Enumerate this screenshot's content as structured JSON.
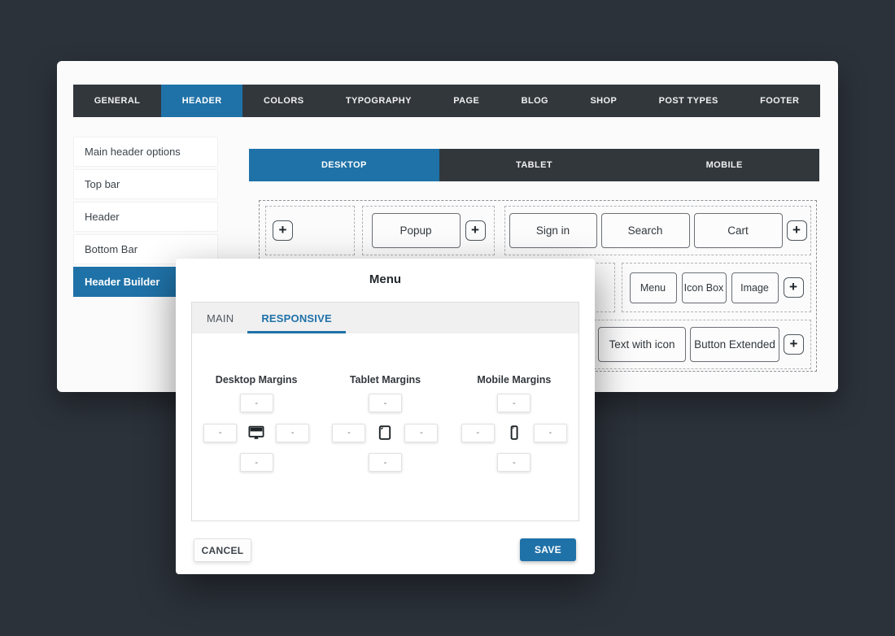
{
  "colors": {
    "accent": "#1f72a8",
    "nav_bg": "#32373c",
    "page_bg": "#2c323a"
  },
  "top_nav": {
    "tabs": [
      {
        "label": "GENERAL"
      },
      {
        "label": "HEADER",
        "active": true
      },
      {
        "label": "COLORS"
      },
      {
        "label": "TYPOGRAPHY"
      },
      {
        "label": "PAGE"
      },
      {
        "label": "BLOG"
      },
      {
        "label": "SHOP"
      },
      {
        "label": "POST TYPES"
      },
      {
        "label": "FOOTER"
      }
    ]
  },
  "sidebar": {
    "items": [
      {
        "label": "Main header options"
      },
      {
        "label": "Top bar"
      },
      {
        "label": "Header"
      },
      {
        "label": "Bottom Bar"
      },
      {
        "label": "Header Builder",
        "active": true
      }
    ]
  },
  "device_tabs": [
    {
      "label": "DESKTOP",
      "active": true
    },
    {
      "label": "TABLET"
    },
    {
      "label": "MOBILE"
    }
  ],
  "builder": {
    "add_label": "+",
    "row1": {
      "popup": "Popup",
      "signin": "Sign in",
      "search": "Search",
      "cart": "Cart"
    },
    "row2": {
      "menu": "Menu",
      "icon_box": "Icon Box",
      "image": "Image"
    },
    "row3": {
      "text_with_icon": "Text with icon",
      "button_extended": "Button Extended"
    }
  },
  "modal": {
    "title": "Menu",
    "tabs": {
      "main": "MAIN",
      "responsive": "RESPONSIVE"
    },
    "groups": [
      {
        "label": "Desktop Margins",
        "icon": "monitor-icon",
        "placeholders": {
          "top": "-",
          "left": "-",
          "right": "-",
          "bottom": "-"
        }
      },
      {
        "label": "Tablet Margins",
        "icon": "tablet-icon",
        "placeholders": {
          "top": "-",
          "left": "-",
          "right": "-",
          "bottom": "-"
        }
      },
      {
        "label": "Mobile Margins",
        "icon": "phone-icon",
        "placeholders": {
          "top": "-",
          "left": "-",
          "right": "-",
          "bottom": "-"
        }
      }
    ],
    "cancel_label": "CANCEL",
    "save_label": "SAVE"
  }
}
